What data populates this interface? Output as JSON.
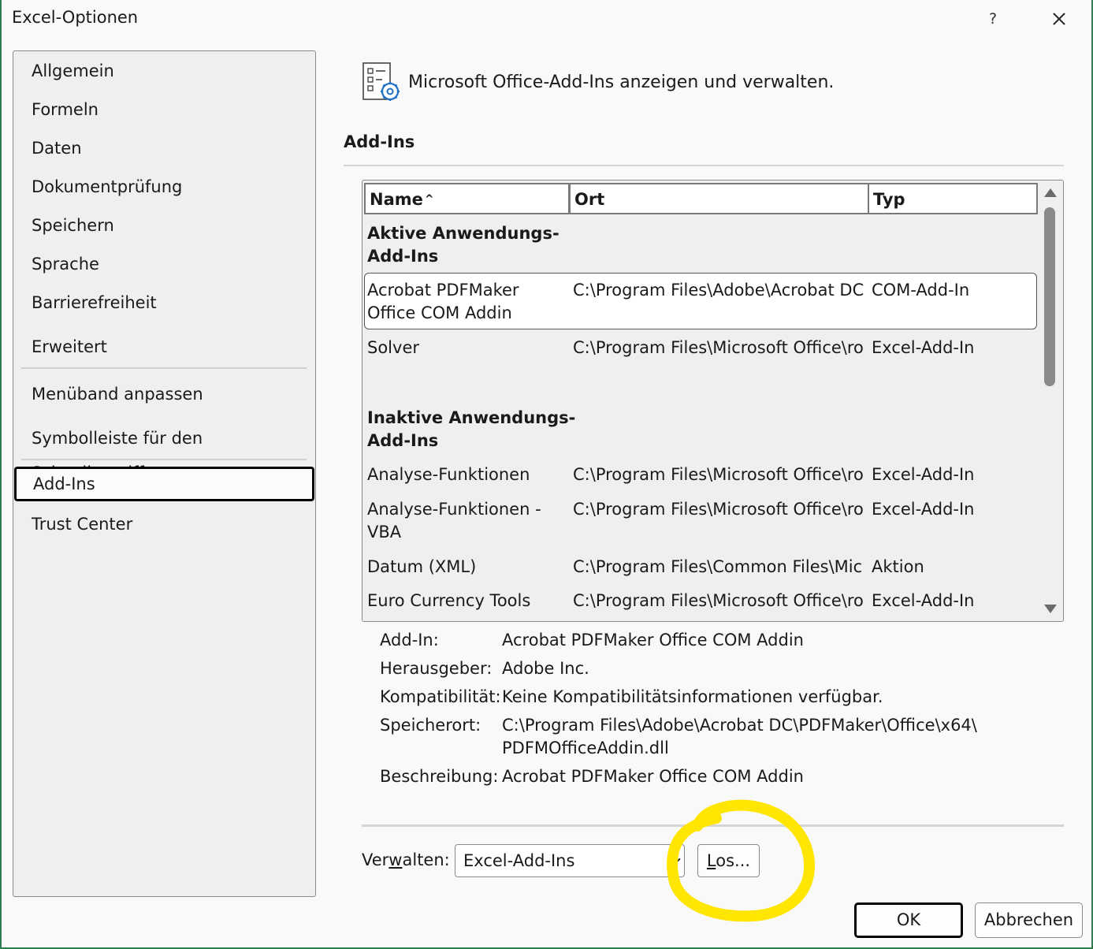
{
  "window": {
    "title": "Excel-Optionen",
    "help_label": "?",
    "close_icon": "close-icon"
  },
  "sidebar": {
    "items": [
      {
        "label": "Allgemein"
      },
      {
        "label": "Formeln"
      },
      {
        "label": "Daten"
      },
      {
        "label": "Dokumentprüfung"
      },
      {
        "label": "Speichern"
      },
      {
        "label": "Sprache"
      },
      {
        "label": "Barrierefreiheit"
      },
      {
        "label": "Erweitert"
      },
      {
        "label": "Menüband anpassen"
      },
      {
        "label": "Symbolleiste für den Schnellzugriff"
      },
      {
        "label": "Add-Ins"
      },
      {
        "label": "Trust Center"
      }
    ],
    "active_label": "Add-Ins"
  },
  "header": {
    "icon": "addins-settings-icon",
    "text": "Microsoft Office-Add-Ins anzeigen und verwalten."
  },
  "section": {
    "title": "Add-Ins"
  },
  "table": {
    "columns": [
      {
        "label": "Name",
        "sort": "ascending"
      },
      {
        "label": "Ort"
      },
      {
        "label": "Typ"
      }
    ],
    "groups": [
      {
        "label_line1": "Aktive Anwendungs-",
        "label_line2": "Add-Ins",
        "rows": [
          {
            "name_line1": "Acrobat PDFMaker",
            "name_line2": "Office COM Addin",
            "location": "C:\\Program Files\\Adobe\\Acrobat DC",
            "type": "COM-Add-In",
            "selected": true
          },
          {
            "name_line1": "Solver",
            "name_line2": "",
            "location": "C:\\Program Files\\Microsoft Office\\ro",
            "type": "Excel-Add-In"
          }
        ]
      },
      {
        "label_line1": "Inaktive Anwendungs-",
        "label_line2": "Add-Ins",
        "rows": [
          {
            "name_line1": "Analyse-Funktionen",
            "name_line2": "",
            "location": "C:\\Program Files\\Microsoft Office\\ro",
            "type": "Excel-Add-In"
          },
          {
            "name_line1": "Analyse-Funktionen -",
            "name_line2": "VBA",
            "location": "C:\\Program Files\\Microsoft Office\\ro",
            "type": "Excel-Add-In"
          },
          {
            "name_line1": "Datum (XML)",
            "name_line2": "",
            "location": "C:\\Program Files\\Common Files\\Mic",
            "type": "Aktion"
          },
          {
            "name_line1": "Euro Currency Tools",
            "name_line2": "",
            "location": "C:\\Program Files\\Microsoft Office\\ro",
            "type": "Excel-Add-In"
          }
        ]
      }
    ]
  },
  "details": {
    "addin_label": "Add-In:",
    "addin_value": "Acrobat PDFMaker Office COM Addin",
    "publisher_label": "Herausgeber:",
    "publisher_value": "Adobe Inc.",
    "compat_label": "Kompatibilität:",
    "compat_value": "Keine Kompatibilitätsinformationen verfügbar.",
    "location_label": "Speicherort:",
    "location_value_line1": "C:\\Program Files\\Adobe\\Acrobat DC\\PDFMaker\\Office\\x64\\",
    "location_value_line2": "PDFMOfficeAddin.dll",
    "desc_label": "Beschreibung:",
    "desc_value": "Acrobat PDFMaker Office COM Addin"
  },
  "manage": {
    "label_pre": "Ver",
    "label_accel": "w",
    "label_post": "alten:",
    "selected": "Excel-Add-Ins",
    "go_accel": "L",
    "go_rest": "os..."
  },
  "footer": {
    "ok_label": "OK",
    "cancel_label": "Abbrechen"
  },
  "colors": {
    "frame_accent": "#2e7d4f",
    "highlight_annotation": "#ffe600"
  }
}
